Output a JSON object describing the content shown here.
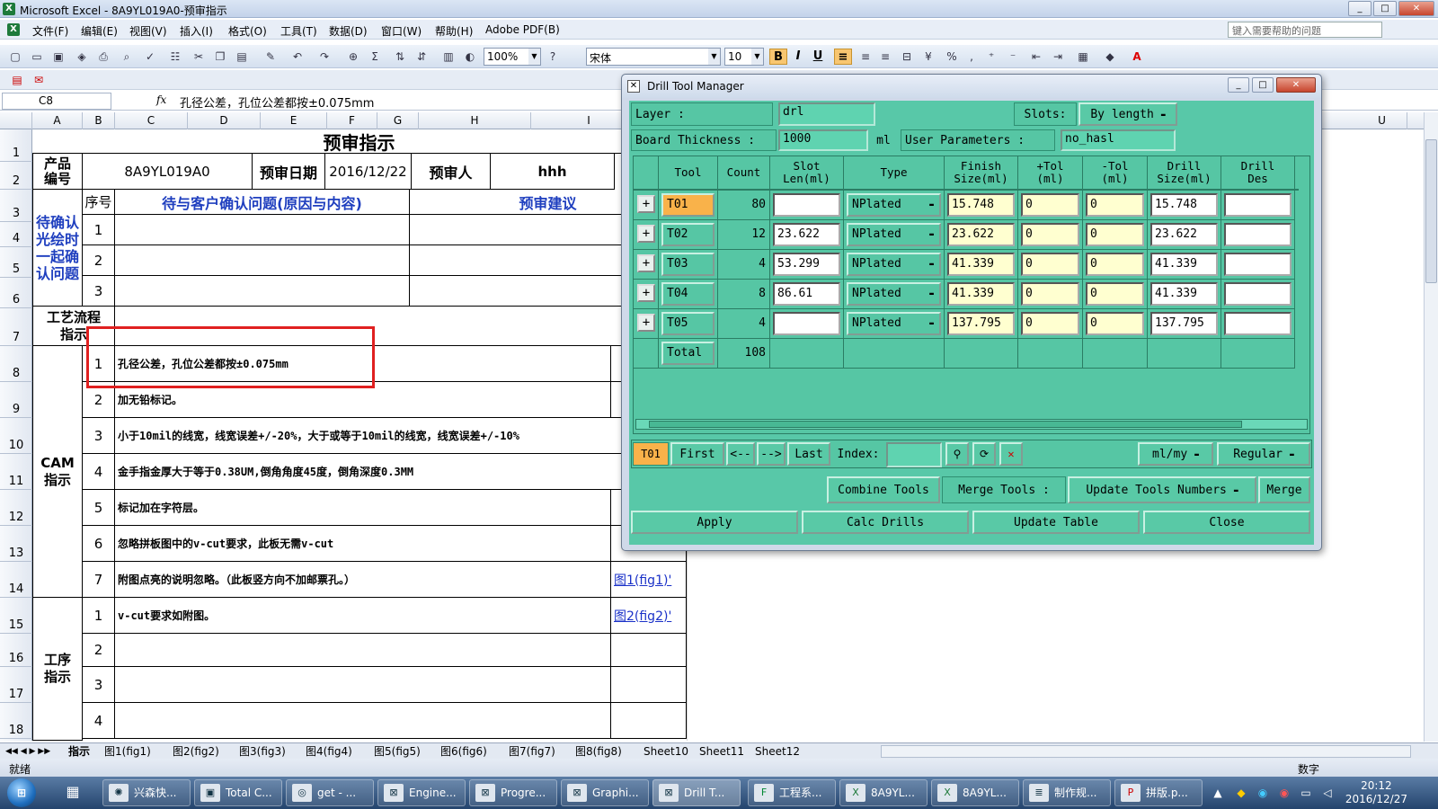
{
  "window": {
    "title": "Microsoft Excel - 8A9YL019A0-预审指示",
    "controls": [
      "_",
      "□",
      "✕"
    ]
  },
  "menu": [
    "文件(F)",
    "编辑(E)",
    "视图(V)",
    "插入(I)",
    "格式(O)",
    "工具(T)",
    "数据(D)",
    "窗口(W)",
    "帮助(H)",
    "Adobe PDF(B)"
  ],
  "help_placeholder": "键入需要帮助的问题",
  "toolbar": {
    "zoom": "100%",
    "font": "宋体",
    "size": "10",
    "bold": "B",
    "italic": "I",
    "underline": "U"
  },
  "formula": {
    "cell": "C8",
    "fx": "fx",
    "value": "孔径公差，孔位公差都按±0.075mm"
  },
  "columns": [
    {
      "n": "A",
      "w": 56
    },
    {
      "n": "B",
      "w": 36
    },
    {
      "n": "C",
      "w": 81
    },
    {
      "n": "D",
      "w": 81
    },
    {
      "n": "E",
      "w": 74
    },
    {
      "n": "F",
      "w": 56
    },
    {
      "n": "G",
      "w": 46
    },
    {
      "n": "H",
      "w": 125
    },
    {
      "n": "I",
      "w": 129
    },
    {
      "n": "U",
      "w": 56
    }
  ],
  "rows": [
    "1",
    "2",
    "3",
    "4",
    "5",
    "6",
    "7",
    "8",
    "9",
    "10",
    "11",
    "12",
    "13",
    "14",
    "15",
    "16",
    "17",
    "18"
  ],
  "sheet": {
    "title": "预审指示",
    "product_label": "产品\n编号",
    "product": "8A9YL019A0",
    "date_label": "预审日期",
    "date": "2016/12/22",
    "reviewer_label": "预审人",
    "reviewer": "hhh",
    "confirm_label": "待确认\n光绘时\n一起确\n认问题",
    "seq_label": "序号",
    "issue_header": "待与客户确认问题(原因与内容)",
    "advice_header": "预审建议",
    "confirm_rows": [
      "1",
      "2",
      "3"
    ],
    "process_label": "工艺流程\n指示",
    "cam_label": "CAM\n指示",
    "cam_items": [
      {
        "n": "1",
        "text": "孔径公差，孔位公差都按±0.075mm",
        "link": ""
      },
      {
        "n": "2",
        "text": "加无铅标记。",
        "link": ""
      },
      {
        "n": "3",
        "text": "小于10mil的线宽，线宽误差+/-20%，大于或等于10mil的线宽，线宽误差+/-10%",
        "link": ""
      },
      {
        "n": "4",
        "text": "金手指金厚大于等于0.38UM,倒角角度45度，倒角深度0.3MM",
        "link": ""
      },
      {
        "n": "5",
        "text": "标记加在字符层。",
        "link": ""
      },
      {
        "n": "6",
        "text": "忽略拼板图中的v-cut要求，此板无需v-cut",
        "link": ""
      },
      {
        "n": "7",
        "text": "附图点亮的说明忽略。（此板竖方向不加邮票孔。）",
        "link": "图1(fig1)'"
      }
    ],
    "proc_label": "工序\n指示",
    "proc_items": [
      {
        "n": "1",
        "text": "v-cut要求如附图。",
        "link": "图2(fig2)'"
      },
      {
        "n": "2",
        "text": "",
        "link": ""
      },
      {
        "n": "3",
        "text": "",
        "link": ""
      },
      {
        "n": "4",
        "text": "",
        "link": ""
      }
    ]
  },
  "sheet_tabs": [
    "指示",
    "图1(fig1)",
    "图2(fig2)",
    "图3(fig3)",
    "图4(fig4)",
    "图5(fig5)",
    "图6(fig6)",
    "图7(fig7)",
    "图8(fig8)",
    "Sheet10",
    "Sheet11",
    "Sheet12"
  ],
  "status": {
    "left": "就绪",
    "right": "数字"
  },
  "dialog": {
    "title": "Drill Tool Manager",
    "layer_label": "Layer         :",
    "layer": "drl",
    "slots_label": "Slots:",
    "slots": "By length",
    "thickness_label": "Board Thickness :",
    "thickness": "1000",
    "thickness_unit": "ml",
    "userparam_label": "User Parameters :",
    "userparam": "no_hasl",
    "headers": [
      "Tool",
      "Count",
      "Slot\nLen(ml)",
      "Type",
      "Finish\nSize(ml)",
      "+Tol\n(ml)",
      "-Tol\n(ml)",
      "Drill\nSize(ml)",
      "Drill\nDes"
    ],
    "tools": [
      {
        "tool": "T01",
        "count": "80",
        "slot": "",
        "type": "NPlated",
        "finish": "15.748",
        "ptol": "0",
        "ntol": "0",
        "drill": "15.748",
        "des": ""
      },
      {
        "tool": "T02",
        "count": "12",
        "slot": "23.622",
        "type": "NPlated",
        "finish": "23.622",
        "ptol": "0",
        "ntol": "0",
        "drill": "23.622",
        "des": ""
      },
      {
        "tool": "T03",
        "count": "4",
        "slot": "53.299",
        "type": "NPlated",
        "finish": "41.339",
        "ptol": "0",
        "ntol": "0",
        "drill": "41.339",
        "des": ""
      },
      {
        "tool": "T04",
        "count": "8",
        "slot": "86.61",
        "type": "NPlated",
        "finish": "41.339",
        "ptol": "0",
        "ntol": "0",
        "drill": "41.339",
        "des": ""
      },
      {
        "tool": "T05",
        "count": "4",
        "slot": "",
        "type": "NPlated",
        "finish": "137.795",
        "ptol": "0",
        "ntol": "0",
        "drill": "137.795",
        "des": ""
      }
    ],
    "total_label": "Total",
    "total": "108",
    "nav": {
      "current": "T01",
      "first": "First",
      "prev": "<--",
      "next": "-->",
      "last": "Last",
      "index": "Index:",
      "units": "ml/my",
      "mode": "Regular"
    },
    "actions": {
      "combine": "Combine Tools",
      "merge_tools": "Merge Tools :",
      "update_numbers": "Update Tools Numbers",
      "merge": "Merge"
    },
    "bottom": {
      "apply": "Apply",
      "calc": "Calc Drills",
      "update": "Update Table",
      "close": "Close"
    }
  },
  "taskbar": {
    "items": [
      "兴森快...",
      "Total C...",
      "get - ...",
      "Engine...",
      "Progre...",
      "Graphi...",
      "Drill T...",
      "工程系...",
      "8A9YL...",
      "8A9YL...",
      "制作规...",
      "拼版.p..."
    ],
    "time": "20:12",
    "date": "2016/12/27"
  }
}
